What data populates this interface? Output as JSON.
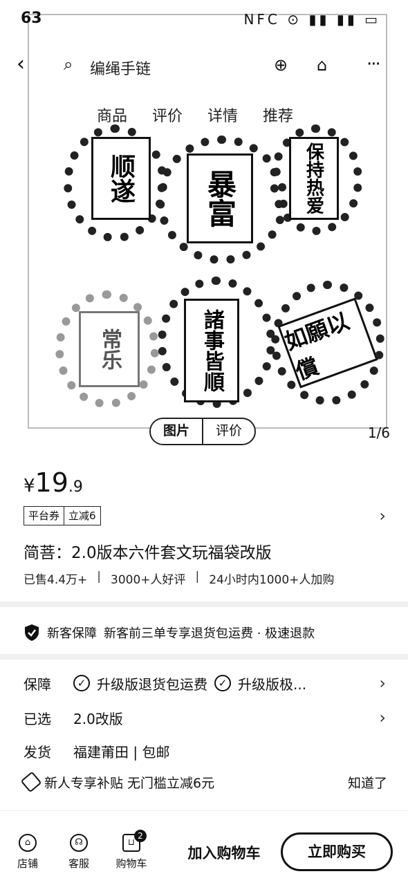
{
  "status": {
    "time": "63",
    "icons": "NFC ⊙ ▮▮ ▮▮ ▭"
  },
  "topbar": {
    "search_text": "编绳手链"
  },
  "tabs": [
    "商品",
    "评价",
    "详情",
    "推荐"
  ],
  "hero": {
    "cards": [
      "顺遂",
      "暴富",
      "保持热爱",
      "常乐",
      "諸事皆順",
      "如願以償"
    ],
    "switch": {
      "image_label": "图片",
      "review_label": "评价"
    },
    "counter": "1/6"
  },
  "price": {
    "currency": "¥",
    "integer": "19",
    "decimal": ".9"
  },
  "coupon": {
    "left": "平台券",
    "right": "立减6"
  },
  "product_title": "简菩：2.0版本六件套文玩福袋改版",
  "stats": {
    "sold": "已售4.4万+",
    "good_reviews": "3000+人好评",
    "recent": "24小时内1000+人加购"
  },
  "guarantee_banner": {
    "name": "新客保障",
    "text": "新客前三单专享退货包运费 · 极速退款"
  },
  "rows": {
    "guarantee": {
      "label": "保障",
      "item1": "升级版退货包运费",
      "item2": "升级版极..."
    },
    "selected": {
      "label": "已选",
      "value": "2.0改版"
    },
    "shipping": {
      "label": "发货",
      "value": "福建莆田 | 包邮"
    }
  },
  "subsidy": {
    "text": "新人专享补贴 无门槛立减6元",
    "action": "知道了"
  },
  "bottombar": {
    "shop": "店铺",
    "service": "客服",
    "cart": "购物车",
    "cart_count": "2",
    "add_cart": "加入购物车",
    "buy_now": "立即购买"
  }
}
